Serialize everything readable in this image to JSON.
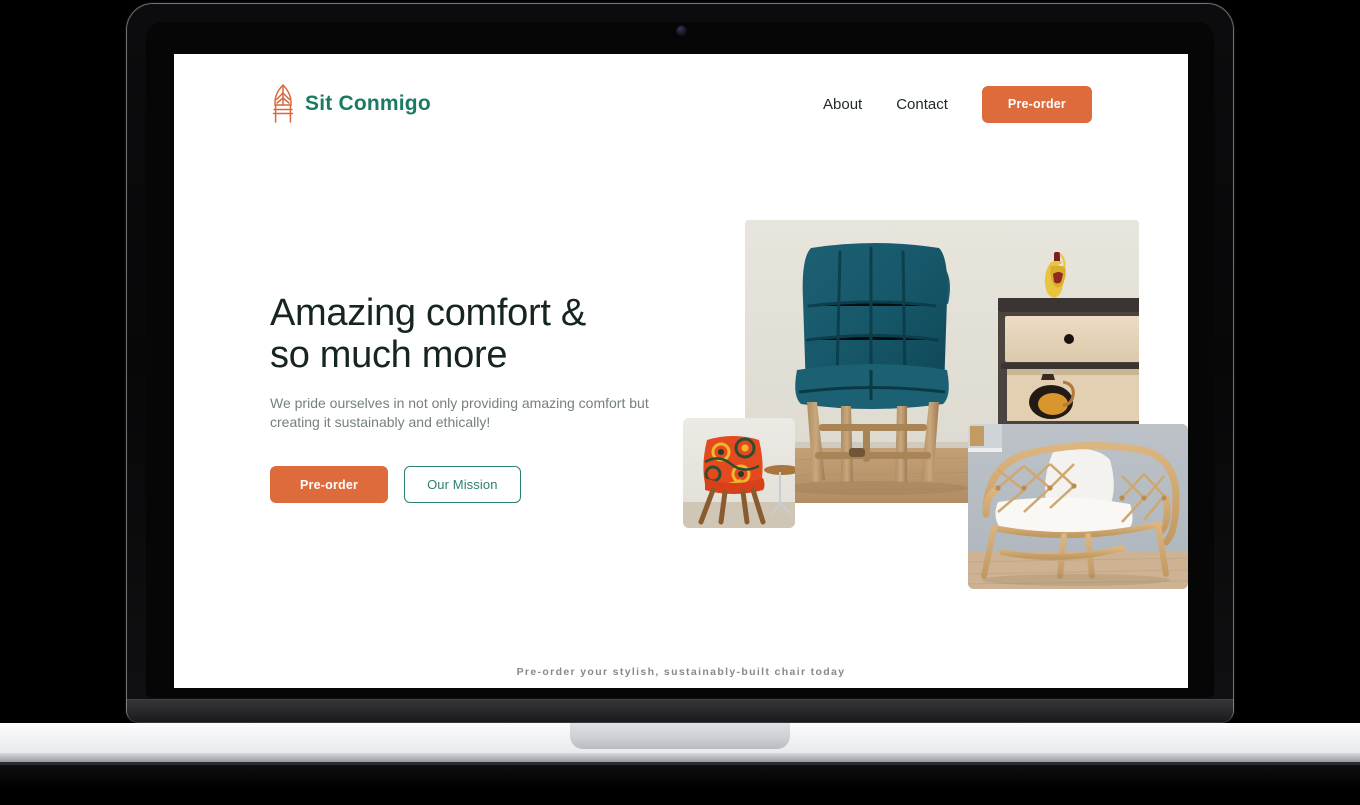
{
  "device": {
    "type": "laptop-mockup",
    "camera": "webcam-dot"
  },
  "site": {
    "brand": {
      "name": "Sit Conmigo",
      "logo_icon": "leaf-chair-icon",
      "logo_color": "#D9693C",
      "text_color": "#1B7A63"
    },
    "nav": {
      "links": [
        {
          "label": "About"
        },
        {
          "label": "Contact"
        }
      ],
      "cta": {
        "label": "Pre-order",
        "bg": "#DD6B3C",
        "color": "#FFFFFF"
      }
    },
    "hero": {
      "title_line_1": "Amazing comfort &",
      "title_line_2": "so much more",
      "subtitle_line_1": "We pride ourselves in not only providing amazing comfort",
      "subtitle_line_2": "but creating it sustainably and ethically!",
      "primary_button": {
        "label": "Pre-order",
        "bg": "#DD6B3C",
        "color": "#FFFFFF"
      },
      "secondary_button": {
        "label": "Our Mission",
        "border": "#2C8070",
        "color": "#2C8070"
      }
    },
    "gallery": [
      {
        "name": "teal-wingback-chair-photo",
        "alt": "Teal upholstered wingback chair with wooden legs beside a wood nightstand with yellow vase"
      },
      {
        "name": "orange-patterned-chair-photo",
        "alt": "Orange patterned accent chair with splayed wooden legs and small round side table"
      },
      {
        "name": "rattan-armchair-photo",
        "alt": "Natural rattan armchair with white cushions against a grey wall"
      }
    ],
    "footer": {
      "tagline": "Pre-order your stylish, sustainably-built chair today",
      "color": "#848B8C"
    }
  }
}
